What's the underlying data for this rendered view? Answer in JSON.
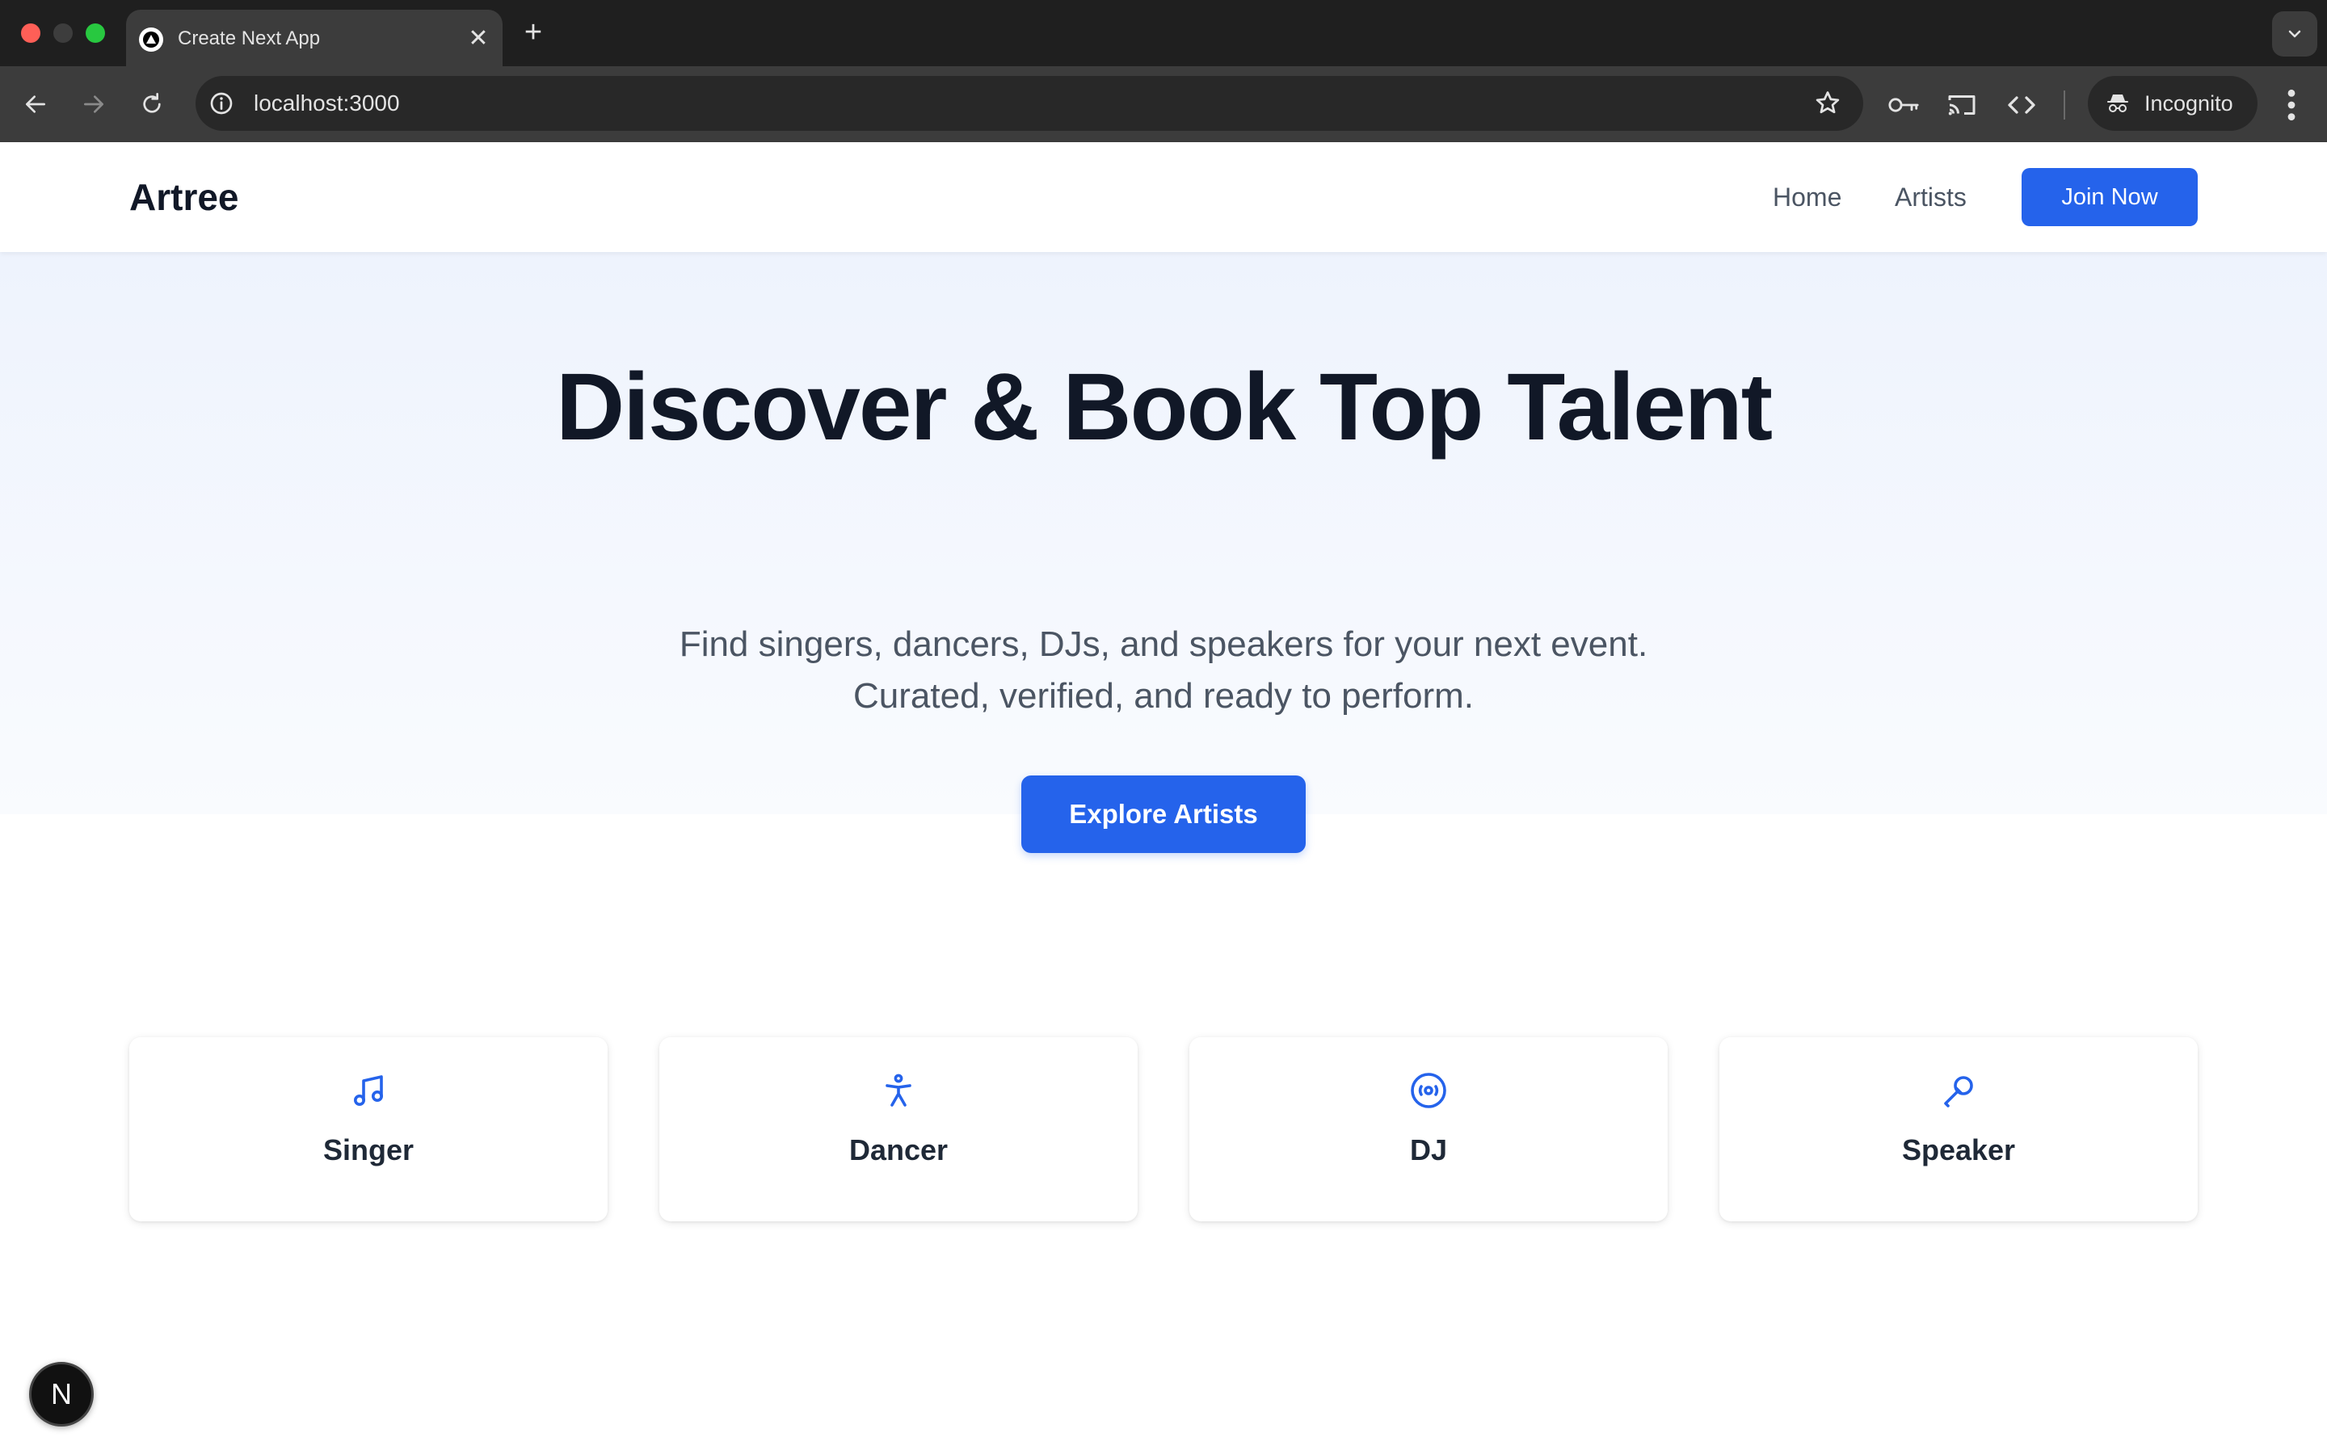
{
  "browser": {
    "tab_title": "Create Next App",
    "tab_close": "✕",
    "new_tab": "+",
    "url": "localhost:3000",
    "profile_label": "Incognito"
  },
  "nav": {
    "logo": "Artree",
    "links": [
      "Home",
      "Artists"
    ],
    "cta": "Join Now"
  },
  "hero": {
    "title": "Discover & Book Top Talent",
    "subtitle_line1": "Find singers, dancers, DJs, and speakers for your next event.",
    "subtitle_line2": "Curated, verified, and ready to perform.",
    "cta": "Explore Artists"
  },
  "categories": [
    {
      "label": "Singer",
      "icon": "music-note-icon"
    },
    {
      "label": "Dancer",
      "icon": "person-icon"
    },
    {
      "label": "DJ",
      "icon": "disc-icon"
    },
    {
      "label": "Speaker",
      "icon": "microphone-icon"
    }
  ],
  "dev_badge": "N",
  "colors": {
    "accent": "#2563eb",
    "heading": "#111827",
    "body_text": "#4b5563",
    "hero_bg_top": "#eef3fd",
    "chrome_dark": "#1f1f1f",
    "chrome_toolbar": "#3c3c3c"
  }
}
